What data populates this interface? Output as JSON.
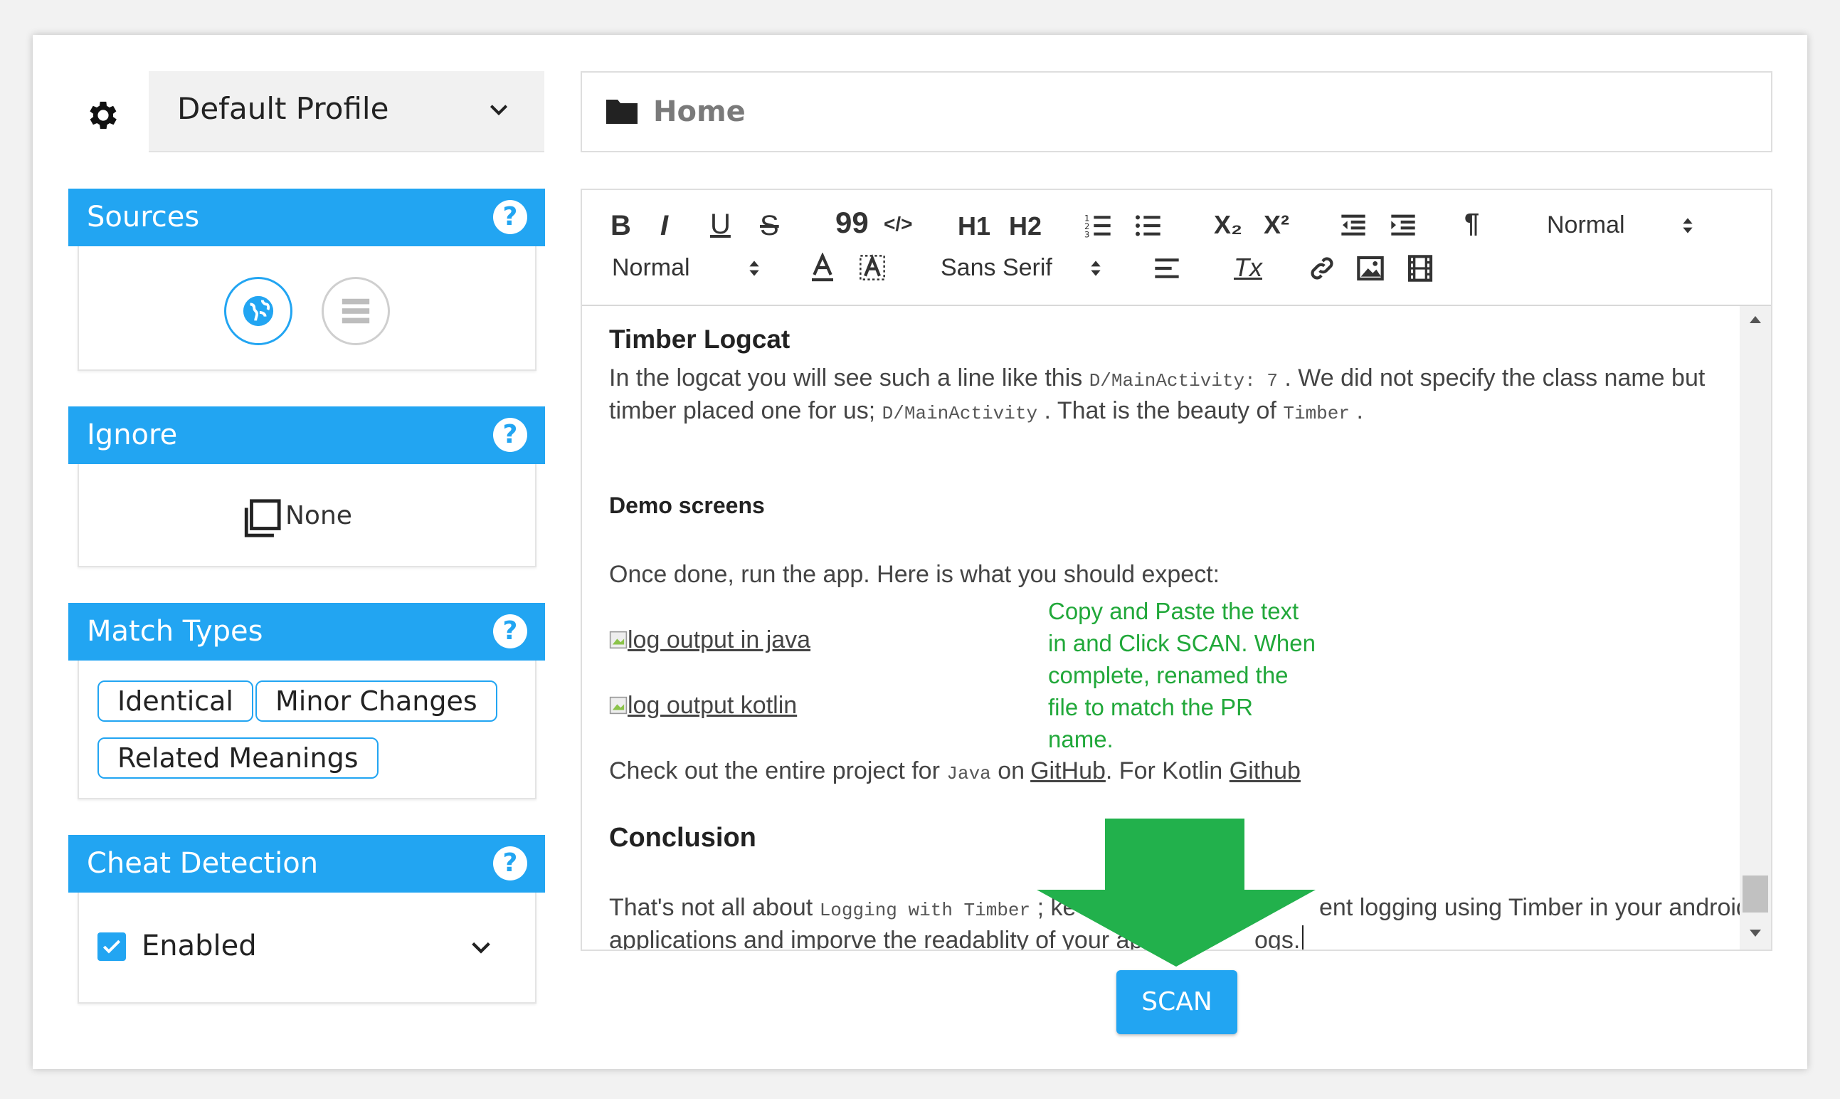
{
  "profile": {
    "label": "Default Profile"
  },
  "home": {
    "label": "Home"
  },
  "sources": {
    "title": "Sources",
    "help": "?"
  },
  "ignore": {
    "title": "Ignore",
    "help": "?",
    "value": "None"
  },
  "match_types": {
    "title": "Match Types",
    "help": "?",
    "chips": [
      "Identical",
      "Minor Changes",
      "Related Meanings"
    ]
  },
  "cheat_detection": {
    "title": "Cheat Detection",
    "help": "?",
    "option": "Enabled",
    "checked": true
  },
  "toolbar": {
    "header_select": "Normal",
    "size_select": "Normal",
    "font_select": "Sans Serif",
    "bold": "B",
    "italic": "I",
    "underline": "U",
    "strike": "S",
    "quote": "99",
    "code": "</>",
    "h1": "H1",
    "h2": "H2",
    "sub": "X₂",
    "sup": "X²",
    "pilcrow": "¶",
    "clear": "Tx"
  },
  "content": {
    "heading1": "Timber Logcat",
    "p1_a": "In the logcat you will see such a line like this",
    "p1_code1": "D/MainActivity: 7",
    "p1_b": ". We did not specify the class name but",
    "p1_c": "timber placed one for us;",
    "p1_code2": "D/MainActivity",
    "p1_d": ". That is the beauty of",
    "p1_code3": "Timber",
    "p1_e": ".",
    "heading2": "Demo screens",
    "p2": "Once done, run the app. Here is what you should expect:",
    "img1": "log output in java",
    "img2": "log output kotlin",
    "p3_a": "Check out the entire project for",
    "p3_code": "Java",
    "p3_b": "on",
    "p3_link1": "GitHub",
    "p3_c": ". For Kotlin",
    "p3_link2": "Github",
    "heading3": "Conclusion",
    "p4_a": "That's not all about",
    "p4_code": "Logging with Timber",
    "p4_b": "; ke",
    "p4_c": "ent logging using Timber in your android",
    "p4_line2a": "applications and imporve the readablity of your app",
    "p4_line2b": "ogs."
  },
  "annotation": {
    "lines": [
      "Copy and Paste the text",
      "in and Click SCAN. When",
      "complete, renamed the",
      "file to match the PR",
      "name."
    ]
  },
  "scan": {
    "label": "SCAN"
  },
  "colors": {
    "accent": "#22a5f2",
    "annotation": "#21a83a",
    "arrow": "#22b14c"
  }
}
